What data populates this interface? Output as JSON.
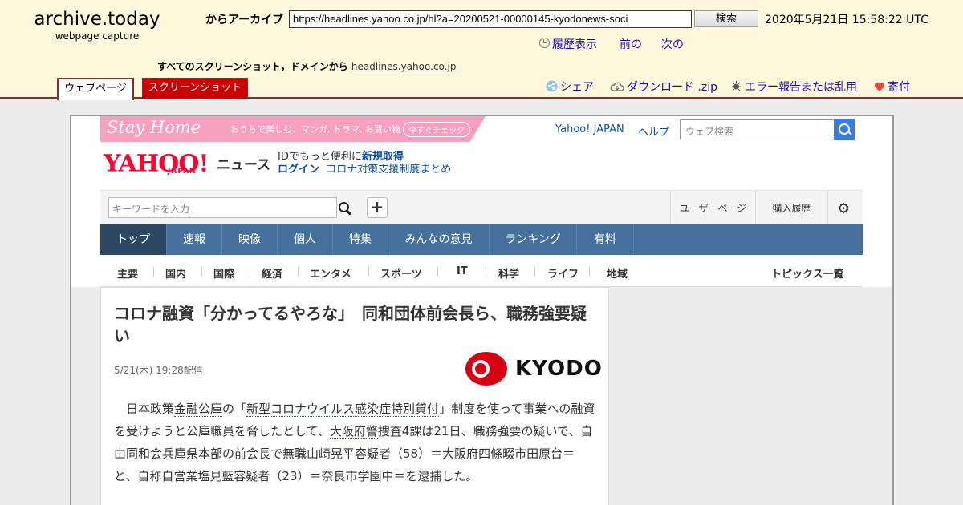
{
  "archive": {
    "logo_title": "archive.today",
    "logo_sub": "webpage capture",
    "url_label": "からアーカイブ",
    "url_value": "https://headlines.yahoo.co.jp/hl?a=20200521-00000145-kyodonews-soci",
    "search_button": "検索",
    "capture_date": "2020年5月21日 15:58:22 UTC",
    "history": "履歴表示",
    "prev": "前の",
    "next": "次の",
    "all_screenshots": "すべてのスクリーンショット，ドメインから",
    "domain": "headlines.yahoo.co.jp",
    "tab_webpage": "ウェブページ",
    "tab_screenshot": "スクリーンショット",
    "share": "シェア",
    "download": "ダウンロード .zip",
    "report": "エラー報告または乱用",
    "donate": "寄付"
  },
  "yahoo": {
    "banner_title": "Stay Home",
    "banner_text": "おうちで楽しむ、マンガ, ドラマ, お買い物",
    "banner_button": "今すぐチェック",
    "top_link_yahoo": "Yahoo! JAPAN",
    "top_link_help": "ヘルプ",
    "web_search_placeholder": "ウェブ検索",
    "logo": "YAHOO!",
    "logo_japan": "JAPAN",
    "news_label": "ニュース",
    "id_text": "IDでもっと便利に",
    "new_account": "新規取得",
    "login": "ログイン",
    "corona_link": "コロナ対策支援制度まとめ",
    "keyword_placeholder": "キーワードを入力",
    "plus": "+",
    "user_page": "ユーザーページ",
    "purchase_history": "購入履歴",
    "nav": [
      "トップ",
      "速報",
      "映像",
      "個人",
      "特集",
      "みんなの意見",
      "ランキング",
      "有料"
    ],
    "categories": [
      "主要",
      "国内",
      "国際",
      "経済",
      "エンタメ",
      "スポーツ",
      "IT",
      "科学",
      "ライフ",
      "地域"
    ],
    "topics_list": "トピックス一覧"
  },
  "article": {
    "headline": "コロナ融資「分かってるやろな」　同和団体前会長ら、職務強要疑い",
    "date": "5/21(木) 19:28配信",
    "source_logo": "KYODO",
    "body_parts": [
      "　日本政策",
      "金融公庫",
      "の「",
      "新型コロナウイルス感染症特別貸付",
      "」制度を使って事業への融資を受けようと公庫職員を脅したとして、",
      "大阪府警",
      "捜査4課は21日、職務強要の疑いで、自由同和会兵庫県本部の前会長で無職山崎晃平容疑者（58）＝大阪府四條畷市田原台＝と、自称自営業塩見藍容疑者（23）＝奈良市学園中＝を逮捕した。"
    ]
  }
}
